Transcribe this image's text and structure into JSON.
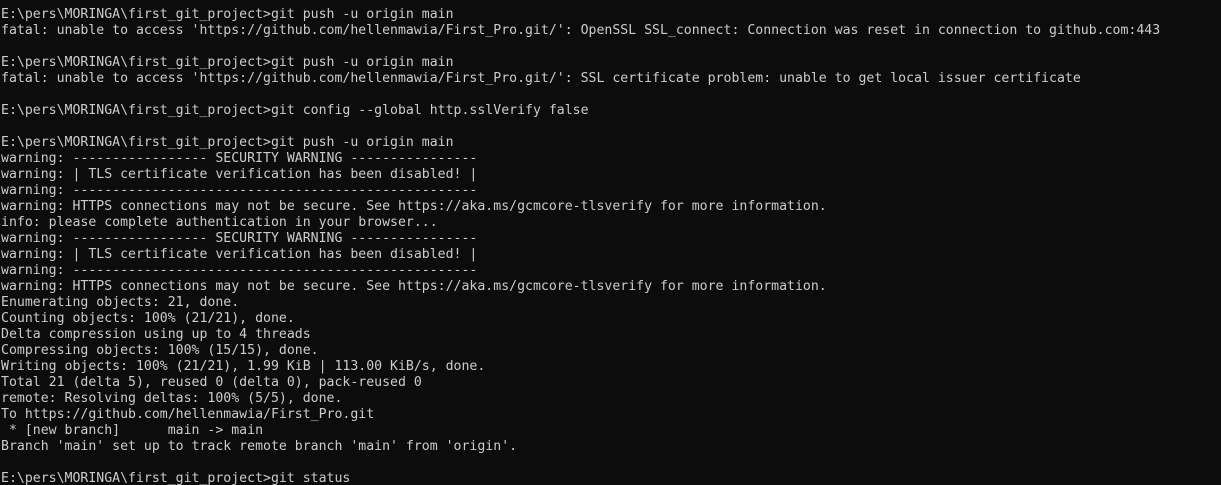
{
  "window": {
    "background_color": "#0c0c0c",
    "text_color": "#cccccc"
  },
  "terminal": {
    "lines": [
      "E:\\pers\\MORINGA\\first_git_project>git push -u origin main",
      "fatal: unable to access 'https://github.com/hellenmawia/First_Pro.git/': OpenSSL SSL_connect: Connection was reset in connection to github.com:443",
      "",
      "E:\\pers\\MORINGA\\first_git_project>git push -u origin main",
      "fatal: unable to access 'https://github.com/hellenmawia/First_Pro.git/': SSL certificate problem: unable to get local issuer certificate",
      "",
      "E:\\pers\\MORINGA\\first_git_project>git config --global http.sslVerify false",
      "",
      "E:\\pers\\MORINGA\\first_git_project>git push -u origin main",
      "warning: ----------------- SECURITY WARNING ----------------",
      "warning: | TLS certificate verification has been disabled! |",
      "warning: ---------------------------------------------------",
      "warning: HTTPS connections may not be secure. See https://aka.ms/gcmcore-tlsverify for more information.",
      "info: please complete authentication in your browser...",
      "warning: ----------------- SECURITY WARNING ----------------",
      "warning: | TLS certificate verification has been disabled! |",
      "warning: ---------------------------------------------------",
      "warning: HTTPS connections may not be secure. See https://aka.ms/gcmcore-tlsverify for more information.",
      "Enumerating objects: 21, done.",
      "Counting objects: 100% (21/21), done.",
      "Delta compression using up to 4 threads",
      "Compressing objects: 100% (15/15), done.",
      "Writing objects: 100% (21/21), 1.99 KiB | 113.00 KiB/s, done.",
      "Total 21 (delta 5), reused 0 (delta 0), pack-reused 0",
      "remote: Resolving deltas: 100% (5/5), done.",
      "To https://github.com/hellenmawia/First_Pro.git",
      " * [new branch]      main -> main",
      "Branch 'main' set up to track remote branch 'main' from 'origin'.",
      "",
      "E:\\pers\\MORINGA\\first_git_project>git status"
    ]
  }
}
